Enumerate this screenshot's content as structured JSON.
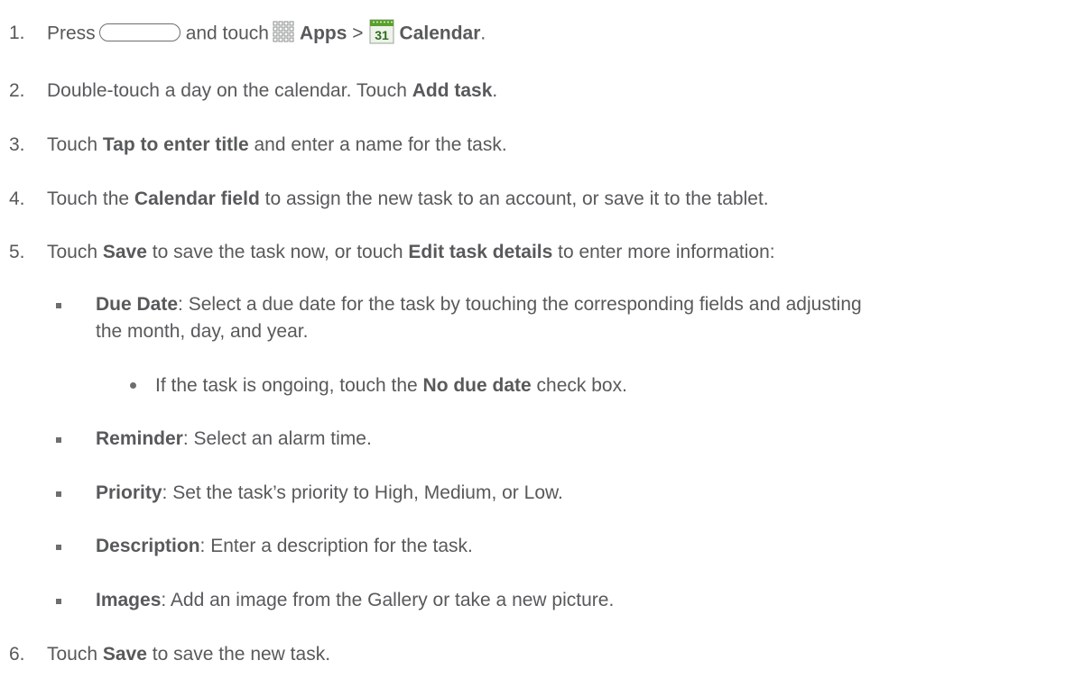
{
  "steps": [
    {
      "num": "1.",
      "parts": {
        "a": "Press",
        "b": "and touch",
        "apps": "Apps",
        "gt": ">",
        "calendar": "Calendar",
        "end": "."
      }
    },
    {
      "num": "2.",
      "a": "Double-touch a day on the calendar. Touch ",
      "bold": "Add task",
      "end": "."
    },
    {
      "num": "3.",
      "a": "Touch ",
      "bold": "Tap to enter title",
      "end": " and enter a name for the task."
    },
    {
      "num": "4.",
      "a": "Touch the ",
      "bold": "Calendar field",
      "end": " to assign the new task to an account, or save it to the tablet."
    },
    {
      "num": "5.",
      "a": "Touch ",
      "bold1": "Save",
      "mid": " to save the task now, or touch ",
      "bold2": "Edit task details",
      "end": " to enter more information:"
    },
    {
      "num": "6.",
      "a": "Touch ",
      "bold": "Save",
      "end": " to save the new task."
    }
  ],
  "sub_items": [
    {
      "bold": "Due Date",
      "text": ": Select a due date for the task by touching the corresponding fields and adjusting",
      "text2": "the month, day, and year."
    },
    {
      "bold": "Reminder",
      "text": ": Select an alarm time."
    },
    {
      "bold": "Priority",
      "text": ": Set the task’s priority to High, Medium, or Low."
    },
    {
      "bold": "Description",
      "text": ": Enter a description for the task."
    },
    {
      "bold": "Images",
      "text": ": Add an image from the Gallery or take a new picture."
    }
  ],
  "sub_sub_item": {
    "a": "If the task is ongoing, touch the ",
    "bold": "No due date",
    "end": " check box."
  },
  "icons": {
    "home_key": "home-key-icon",
    "apps": "apps-grid-icon",
    "calendar": "calendar-icon",
    "calendar_day": "31"
  },
  "colors": {
    "text": "#58595b",
    "calendar_green": "#5aa02c"
  }
}
